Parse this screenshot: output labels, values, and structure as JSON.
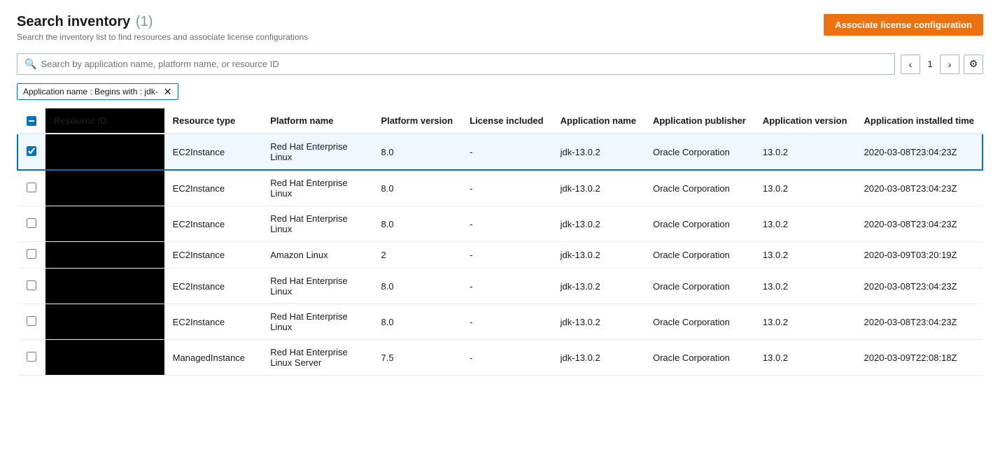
{
  "page": {
    "title": "Search inventory",
    "title_count": "(1)",
    "subtitle": "Search the inventory list to find resources and associate license configurations",
    "associate_btn_label": "Associate license configuration",
    "search_placeholder": "Search by application name, platform name, or resource ID",
    "pagination": {
      "current_page": "1"
    }
  },
  "filters": [
    {
      "label": "Application name : Begins with : jdk-"
    }
  ],
  "table": {
    "columns": [
      {
        "id": "resource_id",
        "label": "Resource ID"
      },
      {
        "id": "resource_type",
        "label": "Resource type"
      },
      {
        "id": "platform_name",
        "label": "Platform name"
      },
      {
        "id": "platform_version",
        "label": "Platform version"
      },
      {
        "id": "license_included",
        "label": "License included"
      },
      {
        "id": "application_name",
        "label": "Application name"
      },
      {
        "id": "application_publisher",
        "label": "Application publisher"
      },
      {
        "id": "application_version",
        "label": "Application version"
      },
      {
        "id": "application_installed_time",
        "label": "Application installed time"
      }
    ],
    "rows": [
      {
        "selected": true,
        "resource_id": "",
        "resource_type": "EC2Instance",
        "platform_name": "Red Hat Enterprise Linux",
        "platform_version": "8.0",
        "license_included": "-",
        "application_name": "jdk-13.0.2",
        "application_publisher": "Oracle Corporation",
        "application_version": "13.0.2",
        "application_installed_time": "2020-03-08T23:04:23Z"
      },
      {
        "selected": false,
        "resource_id": "",
        "resource_type": "EC2Instance",
        "platform_name": "Red Hat Enterprise Linux",
        "platform_version": "8.0",
        "license_included": "-",
        "application_name": "jdk-13.0.2",
        "application_publisher": "Oracle Corporation",
        "application_version": "13.0.2",
        "application_installed_time": "2020-03-08T23:04:23Z"
      },
      {
        "selected": false,
        "resource_id": "",
        "resource_type": "EC2Instance",
        "platform_name": "Red Hat Enterprise Linux",
        "platform_version": "8.0",
        "license_included": "-",
        "application_name": "jdk-13.0.2",
        "application_publisher": "Oracle Corporation",
        "application_version": "13.0.2",
        "application_installed_time": "2020-03-08T23:04:23Z"
      },
      {
        "selected": false,
        "resource_id": "",
        "resource_type": "EC2Instance",
        "platform_name": "Amazon Linux",
        "platform_version": "2",
        "license_included": "-",
        "application_name": "jdk-13.0.2",
        "application_publisher": "Oracle Corporation",
        "application_version": "13.0.2",
        "application_installed_time": "2020-03-09T03:20:19Z"
      },
      {
        "selected": false,
        "resource_id": "",
        "resource_type": "EC2Instance",
        "platform_name": "Red Hat Enterprise Linux",
        "platform_version": "8.0",
        "license_included": "-",
        "application_name": "jdk-13.0.2",
        "application_publisher": "Oracle Corporation",
        "application_version": "13.0.2",
        "application_installed_time": "2020-03-08T23:04:23Z"
      },
      {
        "selected": false,
        "resource_id": "",
        "resource_type": "EC2Instance",
        "platform_name": "Red Hat Enterprise Linux",
        "platform_version": "8.0",
        "license_included": "-",
        "application_name": "jdk-13.0.2",
        "application_publisher": "Oracle Corporation",
        "application_version": "13.0.2",
        "application_installed_time": "2020-03-08T23:04:23Z"
      },
      {
        "selected": false,
        "resource_id": "",
        "resource_type": "ManagedInstance",
        "platform_name": "Red Hat Enterprise Linux Server",
        "platform_version": "7.5",
        "license_included": "-",
        "application_name": "jdk-13.0.2",
        "application_publisher": "Oracle Corporation",
        "application_version": "13.0.2",
        "application_installed_time": "2020-03-09T22:08:18Z"
      }
    ]
  },
  "icons": {
    "search": "🔍",
    "chevron_left": "‹",
    "chevron_right": "›",
    "gear": "⚙",
    "close": "✕"
  }
}
